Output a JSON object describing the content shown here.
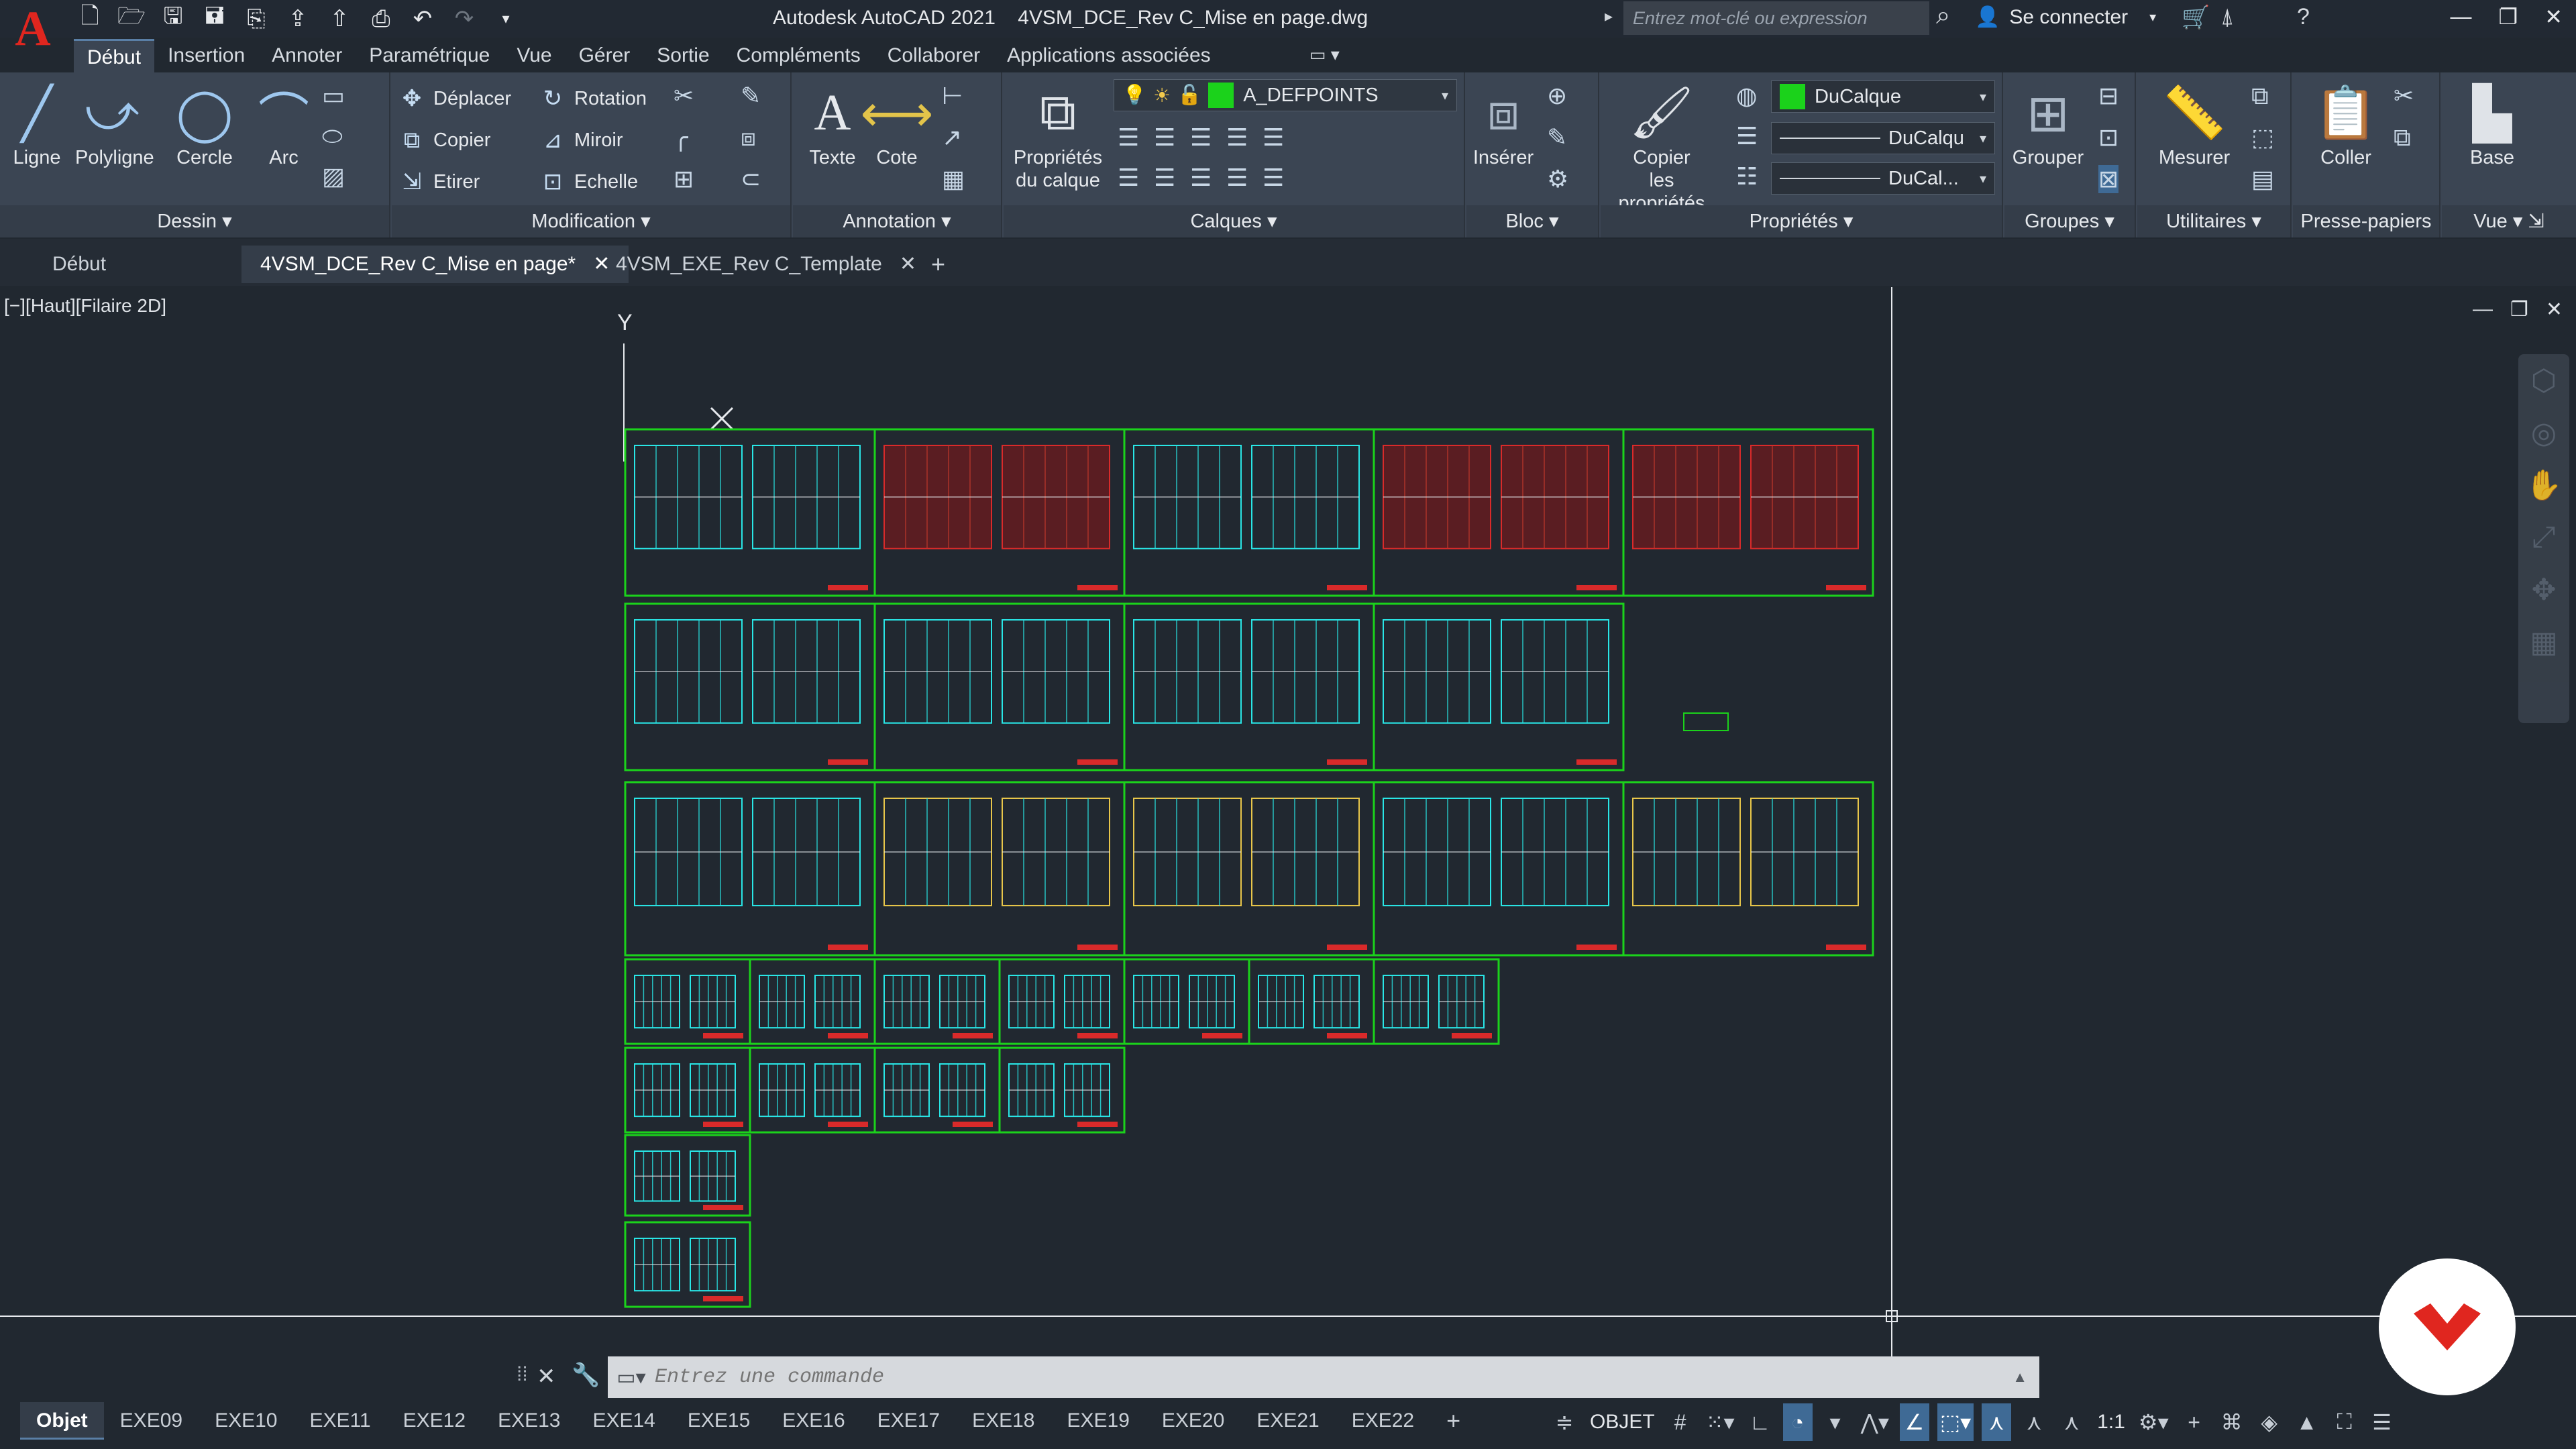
{
  "app": {
    "logo_letter": "A",
    "title": "Autodesk AutoCAD 2021    4VSM_DCE_Rev C_Mise en page.dwg",
    "search_placeholder": "Entrez mot-clé ou expression",
    "signin_label": "Se connecter"
  },
  "ribbon_tabs": [
    "Début",
    "Insertion",
    "Annoter",
    "Paramétrique",
    "Vue",
    "Gérer",
    "Sortie",
    "Compléments",
    "Collaborer",
    "Applications associées"
  ],
  "panels": {
    "dessin": {
      "title": "Dessin",
      "tools": [
        "Ligne",
        "Polyligne",
        "Cercle",
        "Arc"
      ]
    },
    "modification": {
      "title": "Modification",
      "tools": [
        "Déplacer",
        "Rotation",
        "Copier",
        "Miroir",
        "Etirer",
        "Echelle"
      ]
    },
    "annotation": {
      "title": "Annotation",
      "tools": [
        "Texte",
        "Cote"
      ]
    },
    "calques": {
      "title": "Calques",
      "tool": "Propriétés du calque",
      "tool_line1": "Propriétés",
      "tool_line2": "du calque",
      "current_layer": "A_DEFPOINTS"
    },
    "bloc": {
      "title": "Bloc",
      "tool": "Insérer"
    },
    "proprietes": {
      "title": "Propriétés",
      "tool_line1": "Copier",
      "tool_line2": "les propriétés",
      "color": "DuCalque",
      "linetype": "DuCalqu",
      "lineweight": "DuCal..."
    },
    "groupes": {
      "title": "Groupes",
      "tool": "Grouper"
    },
    "utilitaires": {
      "title": "Utilitaires",
      "tool": "Mesurer"
    },
    "presse_papiers": {
      "title": "Presse-papiers",
      "tool": "Coller"
    },
    "vue": {
      "title": "Vue",
      "tool": "Base"
    }
  },
  "doc_tabs": {
    "start": "Début",
    "tab1": "4VSM_DCE_Rev C_Mise en page*",
    "tab2": "4VSM_EXE_Rev C_Template",
    "close": "✕",
    "add": "+"
  },
  "viewport": {
    "label": "[−][Haut][Filaire 2D]",
    "axis_y": "Y"
  },
  "command": {
    "placeholder": "Entrez une commande"
  },
  "layout_tabs": [
    "Objet",
    "EXE09",
    "EXE10",
    "EXE11",
    "EXE12",
    "EXE13",
    "EXE14",
    "EXE15",
    "EXE16",
    "EXE17",
    "EXE18",
    "EXE19",
    "EXE20",
    "EXE21",
    "EXE22"
  ],
  "status": {
    "mode": "OBJET",
    "scale": "1:1"
  },
  "colors": {
    "accent_green": "#1bd21b",
    "cyan": "#29e6e6",
    "red": "#d92a2a",
    "logo_red": "#e0261f"
  }
}
